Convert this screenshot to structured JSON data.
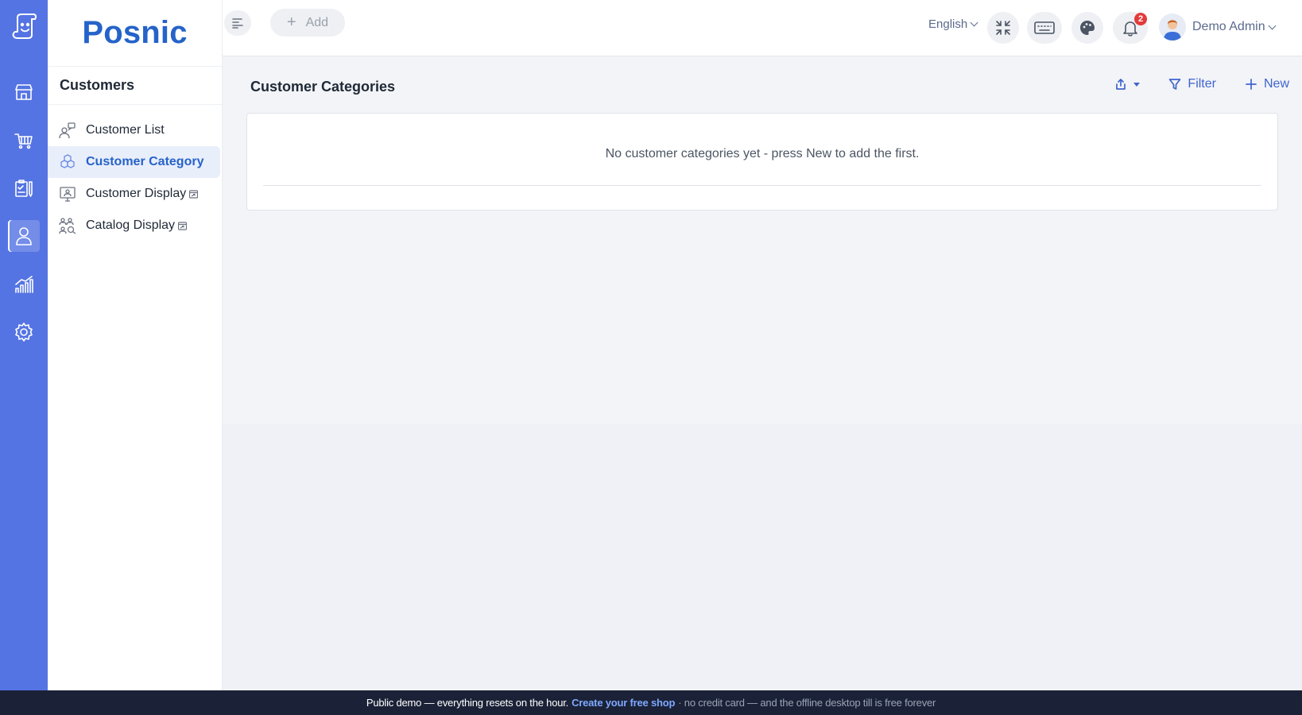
{
  "brand": {
    "name": "Posnic"
  },
  "rail": {
    "items": [
      {
        "name": "store-icon",
        "active": false
      },
      {
        "name": "cart-icon",
        "active": false
      },
      {
        "name": "clipboard-icon",
        "active": false
      },
      {
        "name": "person-icon",
        "active": true
      },
      {
        "name": "chart-bars-icon",
        "active": false
      },
      {
        "name": "gear-icon",
        "active": false
      }
    ]
  },
  "sidebar": {
    "title": "Customers",
    "items": [
      {
        "label": "Customer List",
        "active": false,
        "external": false
      },
      {
        "label": "Customer Category",
        "active": true,
        "external": false
      },
      {
        "label": "Customer Display",
        "active": false,
        "external": true
      },
      {
        "label": "Catalog Display",
        "active": false,
        "external": true
      }
    ]
  },
  "header": {
    "add_label": "Add",
    "language": "English",
    "notifications_count": "2",
    "user_name": "Demo Admin"
  },
  "main": {
    "title": "Customer Categories",
    "filter_label": "Filter",
    "new_label": "New",
    "empty_message": "No customer categories yet - press New to add the first."
  },
  "banner": {
    "text_before": "Public demo — everything resets on the hour.",
    "link_text": "Create your free shop",
    "text_after": "· no credit card — and the offline desktop till is free forever"
  },
  "colors": {
    "rail_bg": "#5574e3",
    "brand": "#2563c9",
    "accent": "#3f64cf",
    "banner_bg": "#1b2237",
    "badge": "#e23b3b"
  }
}
